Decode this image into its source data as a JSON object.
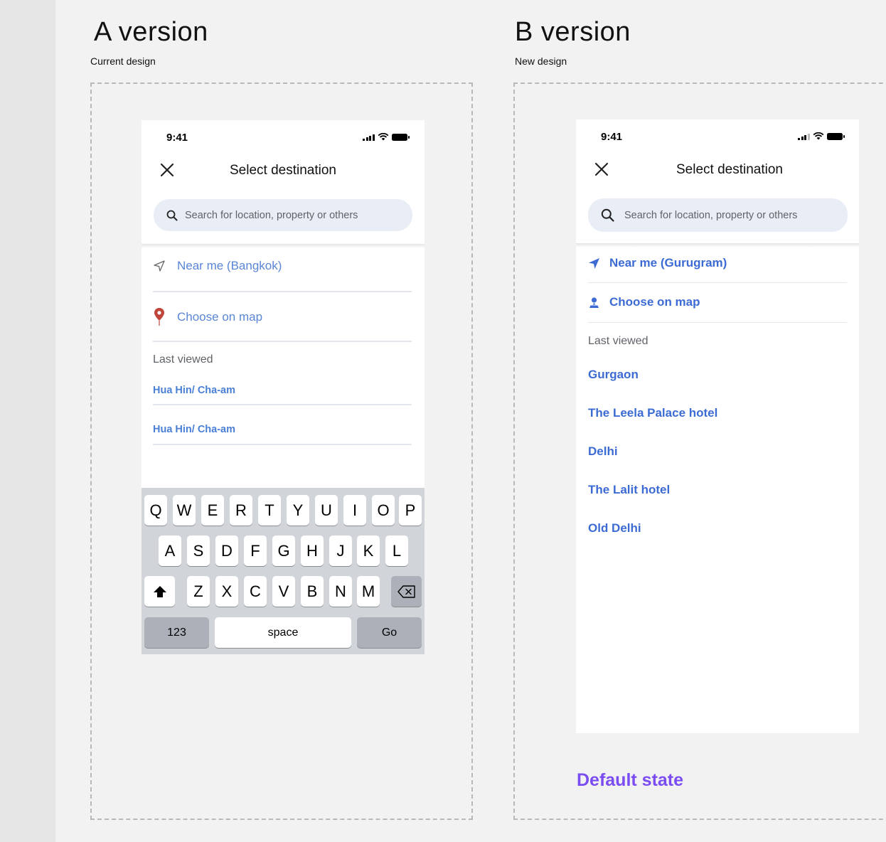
{
  "version_a": {
    "heading": "A  version",
    "subheading": "Current design",
    "phone": {
      "time": "9:41",
      "title": "Select destination",
      "search_placeholder": "Search for location, property or others",
      "near_me": "Near me (Bangkok)",
      "choose_on_map": "Choose on map",
      "last_viewed": "Last viewed",
      "last_viewed_items": [
        "Hua Hin/ Cha-am",
        "Hua Hin/ Cha-am"
      ]
    },
    "keyboard": {
      "row1": [
        "Q",
        "W",
        "E",
        "R",
        "T",
        "Y",
        "U",
        "I",
        "O",
        "P"
      ],
      "row2": [
        "A",
        "S",
        "D",
        "F",
        "G",
        "H",
        "J",
        "K",
        "L"
      ],
      "row3": [
        "Z",
        "X",
        "C",
        "V",
        "B",
        "N",
        "M"
      ],
      "numbers_key": "123",
      "space_key": "space",
      "go_key": "Go"
    }
  },
  "version_b": {
    "heading": "B version",
    "subheading": "New design",
    "phone": {
      "time": "9:41",
      "title": "Select destination",
      "search_placeholder": "Search for location, property or others",
      "near_me": "Near me (Gurugram)",
      "choose_on_map": "Choose on map",
      "last_viewed": "Last viewed",
      "last_viewed_items": [
        "Gurgaon",
        "The Leela Palace hotel",
        "Delhi",
        "The Lalit hotel",
        "Old Delhi"
      ]
    },
    "state_label": "Default state"
  },
  "colors": {
    "canvas": "#f2f2f2",
    "link_a": "#5a86d6",
    "link_b": "#3c6bd3",
    "pin_red": "#c0463b",
    "state_purple": "#7a4cf2"
  }
}
